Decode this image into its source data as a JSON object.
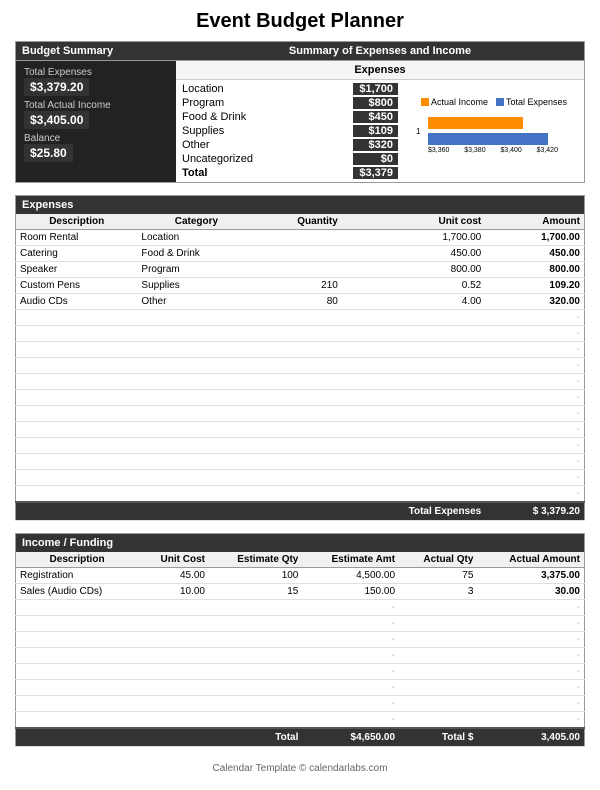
{
  "title": "Event Budget Planner",
  "summary": {
    "header_left": "Budget Summary",
    "header_right": "Summary of Expenses and Income",
    "total_expenses_label": "Total Expenses",
    "total_expenses_value": "$3,379.20",
    "total_income_label": "Total Actual Income",
    "total_income_value": "$3,405.00",
    "balance_label": "Balance",
    "balance_value": "$25.80",
    "expenses_subheader": "Expenses",
    "expense_rows": [
      {
        "label": "Location",
        "value": "$1,700"
      },
      {
        "label": "Program",
        "value": "$800"
      },
      {
        "label": "Food & Drink",
        "value": "$450"
      },
      {
        "label": "Supplies",
        "value": "$109"
      },
      {
        "label": "Other",
        "value": "$320"
      },
      {
        "label": "Uncategorized",
        "value": "$0"
      },
      {
        "label": "Total",
        "value": "$3,379"
      }
    ],
    "chart": {
      "legend_income": "Actual Income",
      "legend_expenses": "Total Expenses",
      "y_label": "1",
      "x_labels": [
        "$3,360.00",
        "$3,380.00",
        "$3,400.00",
        "$3,420.00"
      ],
      "income_bar_width": 95,
      "expenses_bar_width": 120
    }
  },
  "expenses_table": {
    "section_header": "Expenses",
    "columns": [
      "Description",
      "Category",
      "Quantity",
      "Unit cost",
      "Amount"
    ],
    "rows": [
      {
        "description": "Room Rental",
        "category": "Location",
        "quantity": "",
        "unit_cost": "1,700.00",
        "amount": "1,700.00"
      },
      {
        "description": "Catering",
        "category": "Food & Drink",
        "quantity": "",
        "unit_cost": "450.00",
        "amount": "450.00"
      },
      {
        "description": "Speaker",
        "category": "Program",
        "quantity": "",
        "unit_cost": "800.00",
        "amount": "800.00"
      },
      {
        "description": "Custom Pens",
        "category": "Supplies",
        "quantity": "210",
        "unit_cost": "0.52",
        "amount": "109.20"
      },
      {
        "description": "Audio CDs",
        "category": "Other",
        "quantity": "80",
        "unit_cost": "4.00",
        "amount": "320.00"
      }
    ],
    "empty_rows": 12,
    "total_label": "Total Expenses",
    "total_symbol": "$",
    "total_value": "3,379.20"
  },
  "income_table": {
    "section_header": "Income / Funding",
    "columns": [
      "Description",
      "Unit Cost",
      "Estimate Qty",
      "Estimate Amt",
      "Actual Qty",
      "Actual Amount"
    ],
    "rows": [
      {
        "description": "Registration",
        "unit_cost": "45.00",
        "est_qty": "100",
        "est_amt": "4,500.00",
        "actual_qty": "75",
        "actual_amt": "3,375.00"
      },
      {
        "description": "Sales (Audio CDs)",
        "unit_cost": "10.00",
        "est_qty": "15",
        "est_amt": "150.00",
        "actual_qty": "3",
        "actual_amt": "30.00"
      }
    ],
    "empty_rows": 8,
    "total_label": "Total",
    "total_est_value": "$4,650.00",
    "total_actual_label": "Total $",
    "total_actual_value": "3,405.00"
  },
  "footer": {
    "text": "Calendar Template © calendarlabs.com"
  }
}
